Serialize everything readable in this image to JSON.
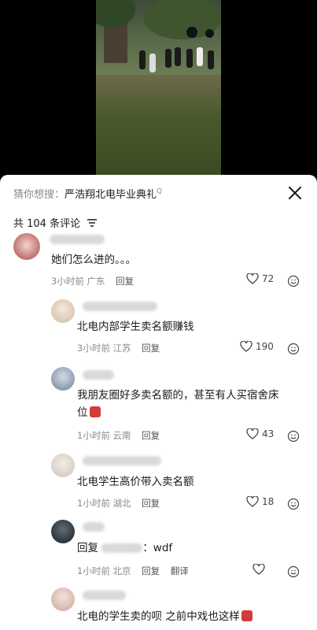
{
  "search": {
    "prefix": "猜你想搜：",
    "query": "严浩翔北电毕业典礼",
    "suffix_icon": "Q"
  },
  "comments_header": {
    "count_text": "共 104 条评论"
  },
  "comments": [
    {
      "text": "她们怎么进的。。。",
      "time": "3小时前",
      "location": "广东",
      "reply": "回复",
      "likes": "72"
    },
    {
      "text": "北电内部学生卖名额赚钱",
      "time": "3小时前",
      "location": "江苏",
      "reply": "回复",
      "likes": "190"
    },
    {
      "text_line1": "我朋友圈好多卖名额的，甚至有人买宿舍床",
      "text_line2": "位",
      "time": "1小时前",
      "location": "云南",
      "reply": "回复",
      "likes": "43"
    },
    {
      "text": "北电学生高价带入卖名额",
      "time": "1小时前",
      "location": "湖北",
      "reply": "回复",
      "likes": "18"
    },
    {
      "reply_prefix": "回复",
      "reply_text": "：wdf",
      "time": "1小时前",
      "location": "北京",
      "reply": "回复",
      "translate": "翻译"
    },
    {
      "text": "北电的学生卖的呗 之前中戏也这样"
    }
  ],
  "icons": {
    "close": "close-icon",
    "filter": "filter-icon",
    "heart": "heart-icon",
    "emoji": "emoji-icon"
  },
  "colors": {
    "text": "#1a1a1a",
    "meta": "#8a8a8a",
    "panel": "#ffffff"
  }
}
